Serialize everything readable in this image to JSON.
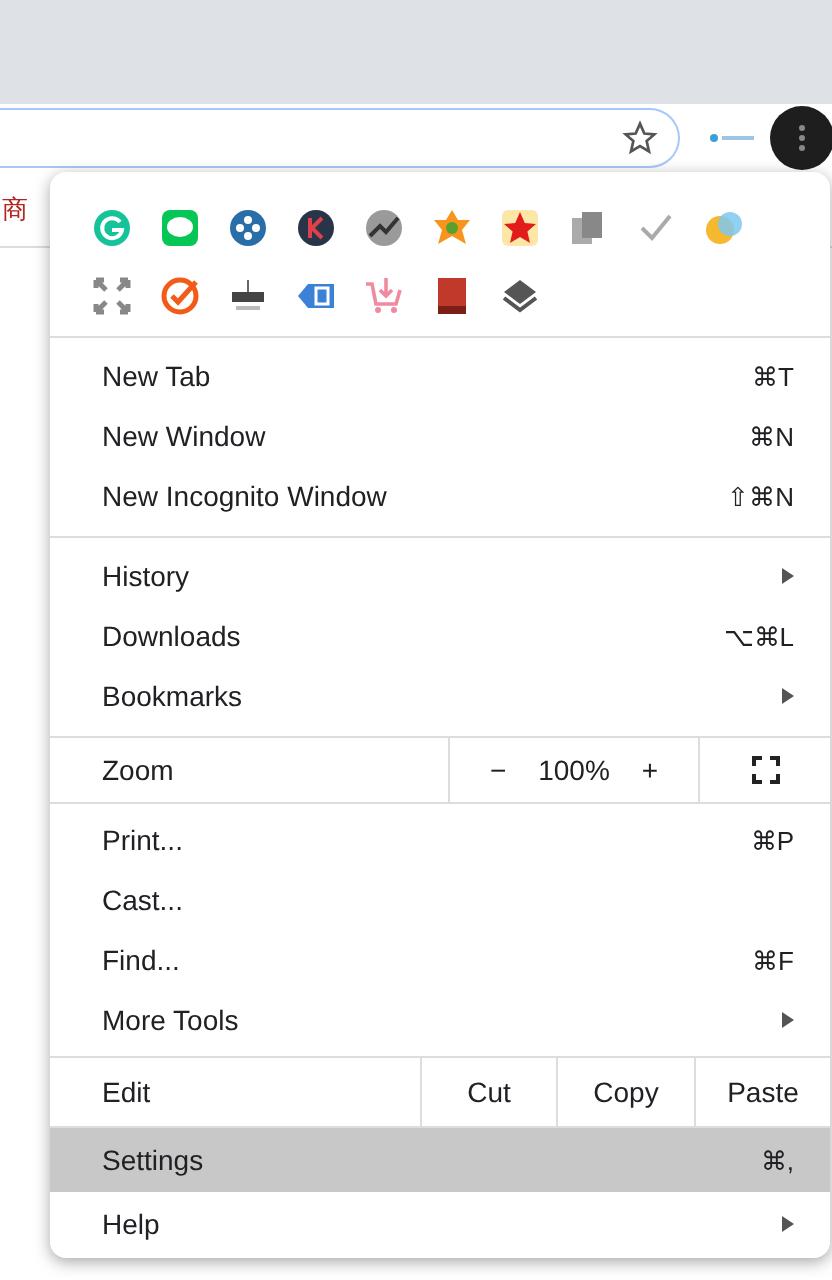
{
  "page_text": "商",
  "menu": {
    "sections": [
      {
        "items": [
          {
            "kind": "command",
            "label": "New Tab",
            "shortcut": "⌘T",
            "submenu": false,
            "selected": false
          },
          {
            "kind": "command",
            "label": "New Window",
            "shortcut": "⌘N",
            "submenu": false,
            "selected": false
          },
          {
            "kind": "command",
            "label": "New Incognito Window",
            "shortcut": "⇧⌘N",
            "submenu": false,
            "selected": false
          }
        ]
      },
      {
        "items": [
          {
            "kind": "command",
            "label": "History",
            "submenu": true,
            "selected": false
          },
          {
            "kind": "command",
            "label": "Downloads",
            "shortcut": "⌥⌘L",
            "submenu": false,
            "selected": false
          },
          {
            "kind": "command",
            "label": "Bookmarks",
            "submenu": true,
            "selected": false
          }
        ]
      },
      {
        "items": [
          {
            "kind": "zoom",
            "label": "Zoom",
            "minus": "−",
            "value": "100%",
            "plus": "+",
            "selected": false
          }
        ]
      },
      {
        "items": [
          {
            "kind": "command",
            "label": "Print...",
            "shortcut": "⌘P",
            "submenu": false,
            "selected": false
          },
          {
            "kind": "command",
            "label": "Cast...",
            "submenu": false,
            "selected": false
          },
          {
            "kind": "command",
            "label": "Find...",
            "shortcut": "⌘F",
            "submenu": false,
            "selected": false
          },
          {
            "kind": "command",
            "label": "More Tools",
            "submenu": true,
            "selected": false
          }
        ]
      },
      {
        "items": [
          {
            "kind": "edit",
            "label": "Edit",
            "actions": [
              "Cut",
              "Copy",
              "Paste"
            ],
            "selected": false
          }
        ]
      },
      {
        "items": [
          {
            "kind": "command",
            "label": "Settings",
            "shortcut": "⌘,",
            "submenu": false,
            "selected": true
          },
          {
            "kind": "command",
            "label": "Help",
            "submenu": true,
            "selected": false
          }
        ]
      }
    ]
  }
}
